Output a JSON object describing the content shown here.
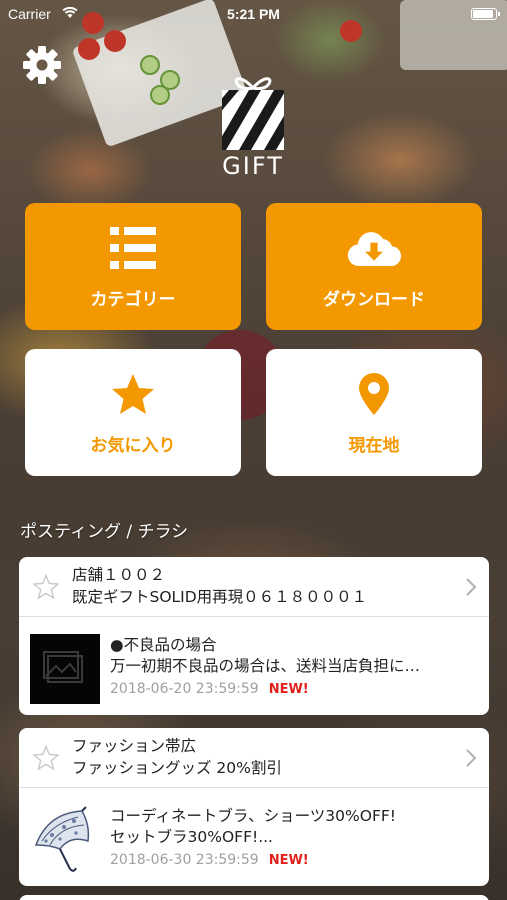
{
  "status_bar": {
    "carrier": "Carrier",
    "time": "5:21 PM"
  },
  "logo": {
    "text": "GIFT"
  },
  "menu": [
    {
      "label": "カテゴリー",
      "icon": "list-icon",
      "style": "orange"
    },
    {
      "label": "ダウンロード",
      "icon": "cloud-download-icon",
      "style": "orange"
    },
    {
      "label": "お気に入り",
      "icon": "star-icon",
      "style": "white"
    },
    {
      "label": "現在地",
      "icon": "map-pin-icon",
      "style": "white"
    }
  ],
  "section_title": "ポスティング / チラシ",
  "posts": [
    {
      "shop_name": "店舗１００２",
      "shop_desc": "既定ギフトSOLID用再現０６１８０００１",
      "title_line1": "●不良品の場合",
      "title_line2": "万一初期不良品の場合は、送料当店負担に…",
      "date": "2018-06-20 23:59:59",
      "badge": "NEW!",
      "thumb": "image-placeholder-icon"
    },
    {
      "shop_name": "ファッション帯広",
      "shop_desc": "ファッショングッズ 20%割引",
      "title_line1": "コーディネートブラ、ショーツ30%OFF!",
      "title_line2": "セットブラ30%OFF!...",
      "date": "2018-06-30 23:59:59",
      "badge": "NEW!",
      "thumb": "umbrella-image"
    }
  ],
  "colors": {
    "accent": "#f39800",
    "new_badge": "#e0201a",
    "date": "#a0a0a0"
  }
}
